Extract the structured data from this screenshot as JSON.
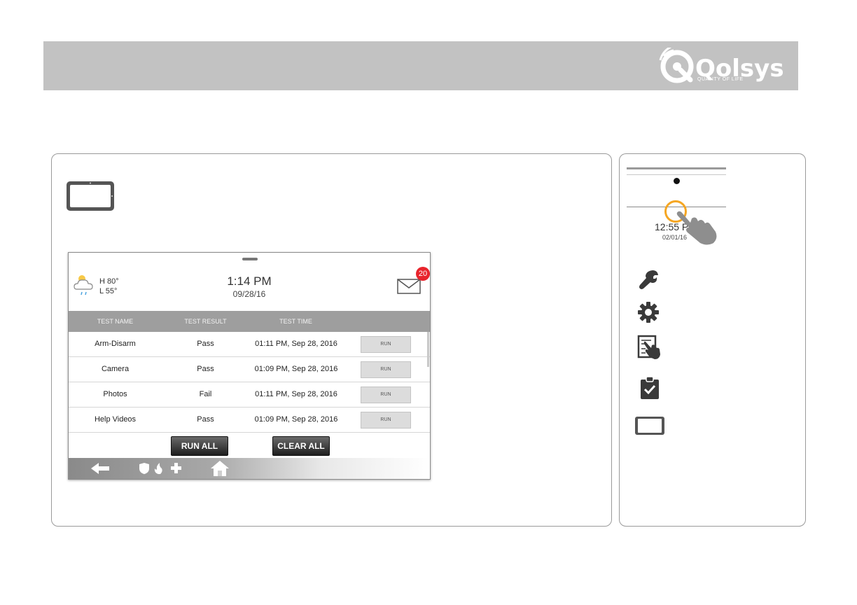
{
  "brand": {
    "name": "Qolsys",
    "tagline": "QUALITY OF LIFE"
  },
  "screen": {
    "weather": {
      "high": "H 80°",
      "low": "L 55°"
    },
    "clock": {
      "time": "1:14 PM",
      "date": "09/28/16"
    },
    "messages_badge": "20",
    "table": {
      "headers": [
        "TEST NAME",
        "TEST RESULT",
        "TEST TIME"
      ],
      "rows": [
        {
          "name": "Arm-Disarm",
          "result": "Pass",
          "time": "01:11 PM, Sep 28, 2016",
          "action": "RUN"
        },
        {
          "name": "Camera",
          "result": "Pass",
          "time": "01:09 PM, Sep 28, 2016",
          "action": "RUN"
        },
        {
          "name": "Photos",
          "result": "Fail",
          "time": "01:11 PM, Sep 28, 2016",
          "action": "RUN"
        },
        {
          "name": "Help Videos",
          "result": "Pass",
          "time": "01:09 PM, Sep 28, 2016",
          "action": "RUN"
        }
      ]
    },
    "buttons": {
      "run_all": "RUN ALL",
      "clear_all": "CLEAR ALL"
    }
  },
  "sidebar": {
    "clock_time": "12:55 P",
    "clock_date": "02/01/16",
    "icons": [
      "wrench-icon",
      "gear-icon",
      "touch-panel-icon",
      "clipboard-check-icon",
      "tablet-icon"
    ]
  },
  "colors": {
    "header": "#c2c2c2",
    "badge": "#e8242c",
    "highlight": "#f5a623"
  }
}
